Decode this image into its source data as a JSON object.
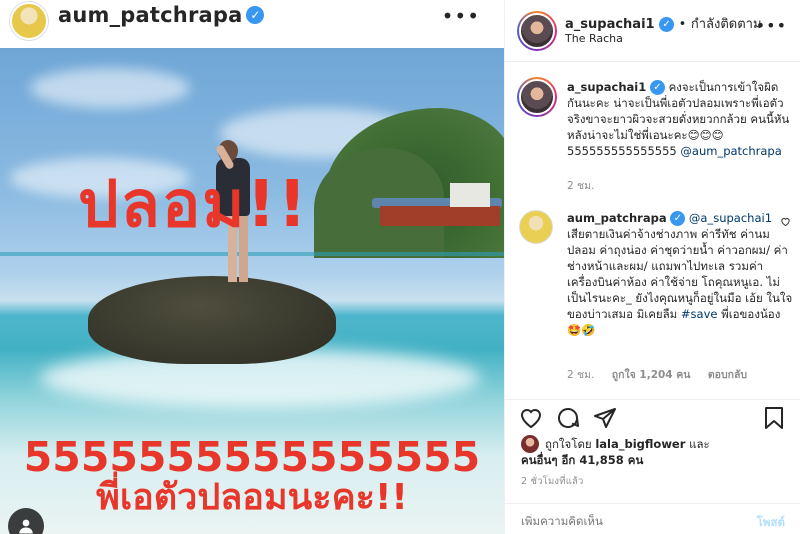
{
  "post_owner": {
    "username": "aum_patchrapa",
    "verified_glyph": "✓",
    "more_glyph": "•••"
  },
  "photo": {
    "overlay_top": "ปลอม!!",
    "overlay_bottom_line1": "5555555555555555",
    "overlay_bottom_line2": "พี่เอตัวปลอมนะคะ!!",
    "tagged_icon": "person-icon"
  },
  "panel_header": {
    "username": "a_supachai1",
    "separator": "•",
    "follow_status": "กำลังติดตาม",
    "location": "The Racha",
    "more_glyph": "•••"
  },
  "comments": [
    {
      "username": "a_supachai1",
      "text": "คงจะเป็นการเข้าใจผิดกันนะคะ น่าจะเป็นพี่เอตัวปลอมเพราะพี่เอตัวจริงขาจะยาวผิวจะสวยดั่งหยวกกล้วย คนนี้หันหลังน่าจะไม่ใช่พี่เอนะคะ😊😊😊 555555555555555 ",
      "mention": "@aum_patchrapa",
      "time": "2 ชม."
    },
    {
      "username": "aum_patchrapa",
      "mention": "@a_supachai1",
      "text": "เสียตายเงินค่าจ้างช่างภาพ ค่ารีทัช ค่านมปลอม ค่าถุงน่อง ค่าชุดว่ายน้ำ ค่าวอกผม/ ค่าช่างหน้าและผม/ แถมพาไปทะเล รวมค่าเครื่องบินค่าห้อง ค่าใช้จ่าย โถคุณหนูเอ. ไม่เป็นไรนะคะ_ ยังไงคุณหนูก็อยู่ในมือ เอ้ย ในใจของบ่าวเสมอ มิเคยลืม ",
      "hashtag": "#save",
      "text_end": " พี่เอของน้อง🤩🤣",
      "time": "2 ชม.",
      "likes": "ถูกใจ 1,204 คน",
      "reply": "ตอบกลับ"
    }
  ],
  "actions": {
    "like_icon": "heart-icon",
    "comment_icon": "comment-icon",
    "share_icon": "paper-plane-icon",
    "save_icon": "bookmark-icon"
  },
  "likes": {
    "prefix": "ถูกใจโดย",
    "liker": "lala_bigflower",
    "and": "และ",
    "others": "คนอื่นๆ อีก 41,858 คน"
  },
  "time_ago": "2 ชั่วโมงที่แล้ว",
  "add_comment": {
    "placeholder": "เพิ่มความคิดเห็น",
    "post_label": "โพสต์"
  }
}
